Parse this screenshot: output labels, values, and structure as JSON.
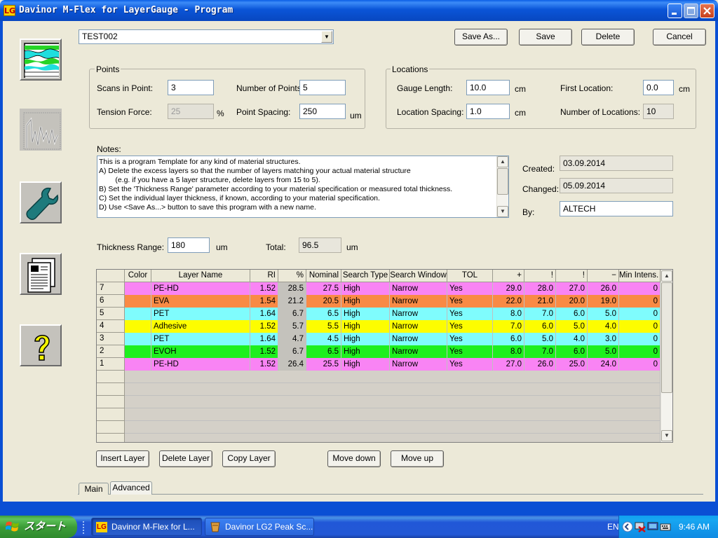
{
  "window": {
    "title": "Davinor M-Flex for LayerGauge - Program",
    "logo_text": "LG"
  },
  "program": {
    "selected": "TEST002"
  },
  "toolbar": {
    "save_as_label": "Save As...",
    "save_label": "Save",
    "delete_label": "Delete",
    "cancel_label": "Cancel"
  },
  "points": {
    "title": "Points",
    "scans_label": "Scans in Point:",
    "scans_value": "3",
    "tension_label": "Tension Force:",
    "tension_value": "25",
    "tension_unit": "%",
    "number_label": "Number of Points:",
    "number_value": "5",
    "spacing_label": "Point Spacing:",
    "spacing_value": "250",
    "spacing_unit": "um"
  },
  "locations": {
    "title": "Locations",
    "gauge_label": "Gauge Length:",
    "gauge_value": "10.0",
    "gauge_unit": "cm",
    "spacing_label": "Location Spacing:",
    "spacing_value": "1.0",
    "spacing_unit": "cm",
    "first_label": "First Location:",
    "first_value": "0.0",
    "first_unit": "cm",
    "count_label": "Number of Locations:",
    "count_value": "10"
  },
  "notes": {
    "label": "Notes:",
    "text": "This is a program Template for any kind of material structures.\nA) Delete the excess layers so that the number of layers matching your actual material structure\n        (e.g. if you have a 5 layer structure, delete layers from 15 to 5).\nB) Set the 'Thickness Range' parameter according to your material specification or measured total thickness.\nC) Set the individual layer thickness, if known, according to your material specification.\nD) Use <Save As...> button to save this program with a new name."
  },
  "meta": {
    "created_label": "Created:",
    "created_value": "03.09.2014",
    "changed_label": "Changed:",
    "changed_value": "05.09.2014",
    "by_label": "By:",
    "by_value": "ALTECH"
  },
  "thickness": {
    "range_label": "Thickness Range:",
    "range_value": "180",
    "range_unit": "um",
    "total_label": "Total:",
    "total_value": "96.5",
    "total_unit": "um"
  },
  "table": {
    "headers": [
      "",
      "Color",
      "Layer Name",
      "RI",
      "%",
      "Nominal",
      "Search Type",
      "Search Window",
      "TOL",
      "+",
      "!",
      "!",
      "−",
      "Min Intens."
    ],
    "rows": [
      {
        "num": "7",
        "color": "#f984f4",
        "name": "PE-HD",
        "ri": "1.52",
        "pct": "28.5",
        "nominal": "27.5",
        "search_type": "High",
        "search_window": "Narrow",
        "tol": "Yes",
        "plus": "29.0",
        "b1": "28.0",
        "b2": "27.0",
        "minus": "26.0",
        "min_int": "0"
      },
      {
        "num": "6",
        "color": "#f98a45",
        "name": "EVA",
        "ri": "1.54",
        "pct": "21.2",
        "nominal": "20.5",
        "search_type": "High",
        "search_window": "Narrow",
        "tol": "Yes",
        "plus": "22.0",
        "b1": "21.0",
        "b2": "20.0",
        "minus": "19.0",
        "min_int": "0"
      },
      {
        "num": "5",
        "color": "#7ffcfd",
        "name": "PET",
        "ri": "1.64",
        "pct": "6.7",
        "nominal": "6.5",
        "search_type": "High",
        "search_window": "Narrow",
        "tol": "Yes",
        "plus": "8.0",
        "b1": "7.0",
        "b2": "6.0",
        "minus": "5.0",
        "min_int": "0"
      },
      {
        "num": "4",
        "color": "#fdfd00",
        "name": "Adhesive",
        "ri": "1.52",
        "pct": "5.7",
        "nominal": "5.5",
        "search_type": "High",
        "search_window": "Narrow",
        "tol": "Yes",
        "plus": "7.0",
        "b1": "6.0",
        "b2": "5.0",
        "minus": "4.0",
        "min_int": "0"
      },
      {
        "num": "3",
        "color": "#7ffcfd",
        "name": "PET",
        "ri": "1.64",
        "pct": "4.7",
        "nominal": "4.5",
        "search_type": "High",
        "search_window": "Narrow",
        "tol": "Yes",
        "plus": "6.0",
        "b1": "5.0",
        "b2": "4.0",
        "minus": "3.0",
        "min_int": "0"
      },
      {
        "num": "2",
        "color": "#1eef1e",
        "name": "EVOH",
        "ri": "1.52",
        "pct": "6.7",
        "nominal": "6.5",
        "search_type": "High",
        "search_window": "Narrow",
        "tol": "Yes",
        "plus": "8.0",
        "b1": "7.0",
        "b2": "6.0",
        "minus": "5.0",
        "min_int": "0"
      },
      {
        "num": "1",
        "color": "#f984f4",
        "name": "PE-HD",
        "ri": "1.52",
        "pct": "26.4",
        "nominal": "25.5",
        "search_type": "High",
        "search_window": "Narrow",
        "tol": "Yes",
        "plus": "27.0",
        "b1": "26.0",
        "b2": "25.0",
        "minus": "24.0",
        "min_int": "0"
      }
    ]
  },
  "layer_buttons": {
    "insert_label": "Insert Layer",
    "delete_label": "Delete Layer",
    "copy_label": "Copy Layer",
    "down_label": "Move down",
    "up_label": "Move up"
  },
  "tabs": {
    "main_label": "Main",
    "advanced_label": "Advanced"
  },
  "taskbar": {
    "start_label": "スタート",
    "task1_label": "Davinor M-Flex for L...",
    "task2_label": "Davinor LG2 Peak Sc...",
    "lang": "EN",
    "clock": "9:46 AM"
  }
}
